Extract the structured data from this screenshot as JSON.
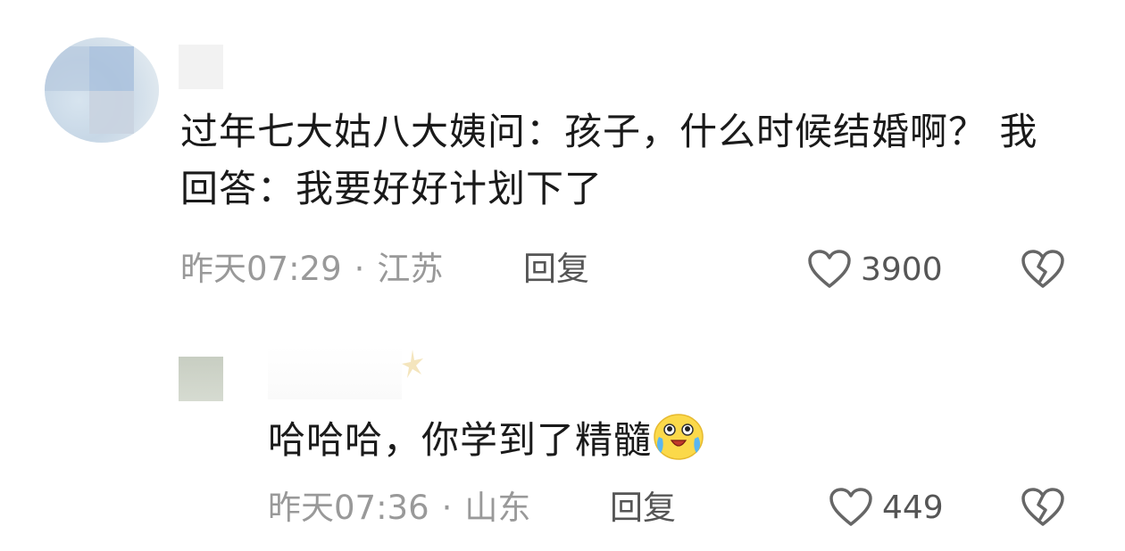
{
  "comments": [
    {
      "text": "过年七大姑八大姨问：孩子，什么时候结婚啊？ 我回答：我要好好计划下了",
      "time": "昨天07:29",
      "separator": "·",
      "location": "江苏",
      "reply_label": "回复",
      "likes": "3900"
    },
    {
      "text": "哈哈哈，你学到了精髓",
      "emoji": "crying-laughing-emoji",
      "time": "昨天07:36",
      "separator": "·",
      "location": "山东",
      "reply_label": "回复",
      "likes": "449"
    }
  ],
  "icons": {
    "like": "heart-outline-icon",
    "dislike": "broken-heart-icon"
  },
  "colors": {
    "text": "#1a1a1a",
    "meta": "#999999",
    "action": "#555555",
    "icon": "#666666"
  }
}
